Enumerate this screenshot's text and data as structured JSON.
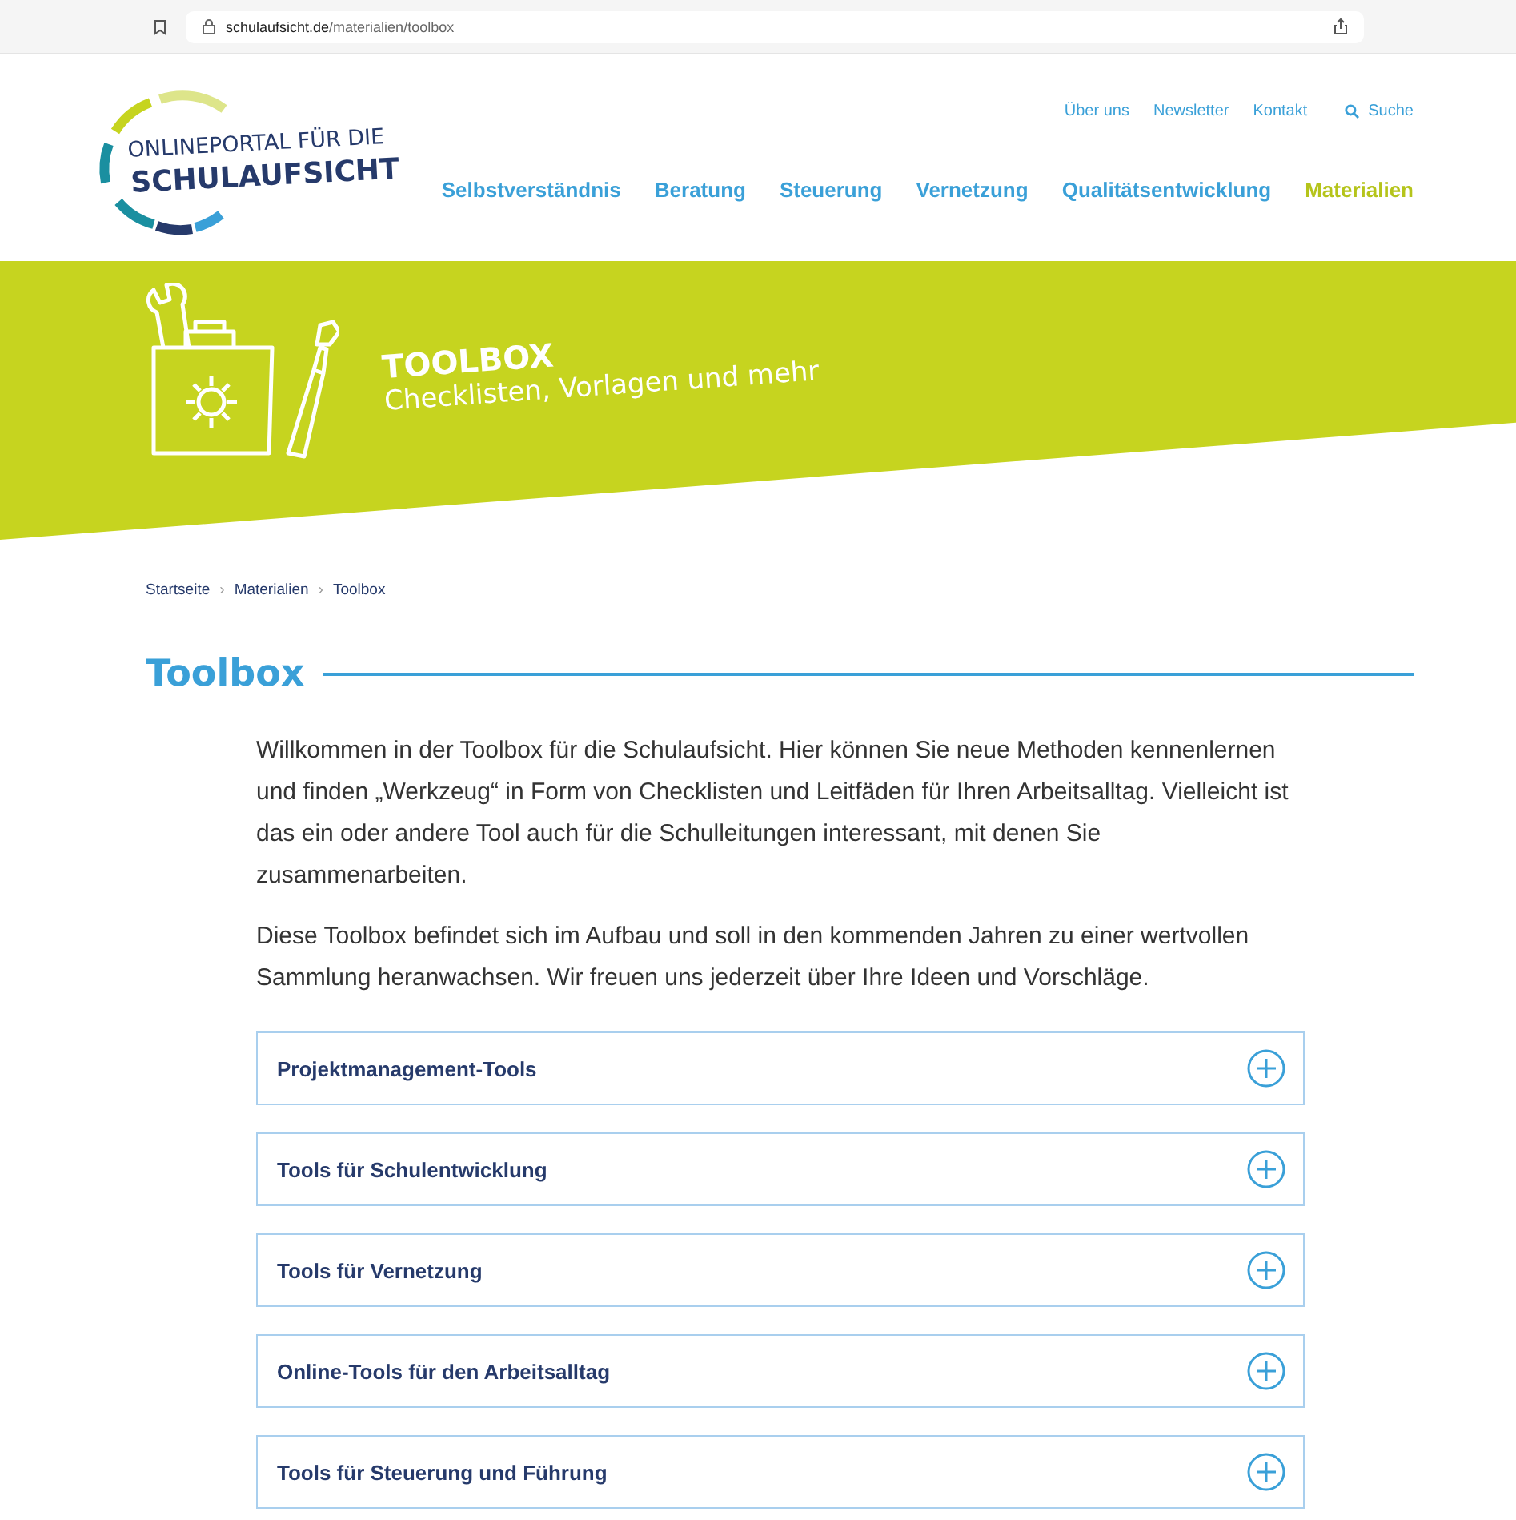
{
  "browser": {
    "url_domain": "schulaufsicht.de",
    "url_path": "/materialien/toolbox"
  },
  "header": {
    "logo_line1": "ONLINEPORTAL FÜR DIE",
    "logo_line2": "SCHULAUFSICHT",
    "service_links": [
      "Über uns",
      "Newsletter",
      "Kontakt"
    ],
    "search_label": "Suche",
    "nav": [
      {
        "label": "Selbstverständnis",
        "selected": false
      },
      {
        "label": "Beratung",
        "selected": false
      },
      {
        "label": "Steuerung",
        "selected": false
      },
      {
        "label": "Vernetzung",
        "selected": false
      },
      {
        "label": "Qualitätsentwicklung",
        "selected": false
      },
      {
        "label": "Materialien",
        "selected": true
      }
    ]
  },
  "banner": {
    "title": "TOOLBOX",
    "subtitle": "Checklisten, Vorlagen und mehr"
  },
  "breadcrumb": [
    "Startseite",
    "Materialien",
    "Toolbox"
  ],
  "breadcrumb_separator": "›",
  "heading": "Toolbox",
  "paragraphs": [
    "Willkommen in der Toolbox für die Schulaufsicht. Hier können Sie neue Methoden kennenlernen und finden „Werkzeug“ in Form von Checklisten und Leitfäden für Ihren Arbeitsalltag. Vielleicht ist das ein oder andere Tool auch für die Schulleitungen interessant, mit denen Sie zusammenarbeiten.",
    "Diese Toolbox befindet sich im Aufbau und soll in den kommenden Jahren zu einer wertvollen Sammlung heranwachsen. Wir freuen uns jederzeit über Ihre Ideen und Vorschläge."
  ],
  "accordion": [
    {
      "label": "Projektmanagement-Tools",
      "expanded": false
    },
    {
      "label": "Tools für Schulentwicklung",
      "expanded": false
    },
    {
      "label": "Tools für Vernetzung",
      "expanded": false
    },
    {
      "label": "Online-Tools für den Arbeitsalltag",
      "expanded": false
    },
    {
      "label": "Tools für Steuerung und Führung",
      "expanded": false
    }
  ]
}
